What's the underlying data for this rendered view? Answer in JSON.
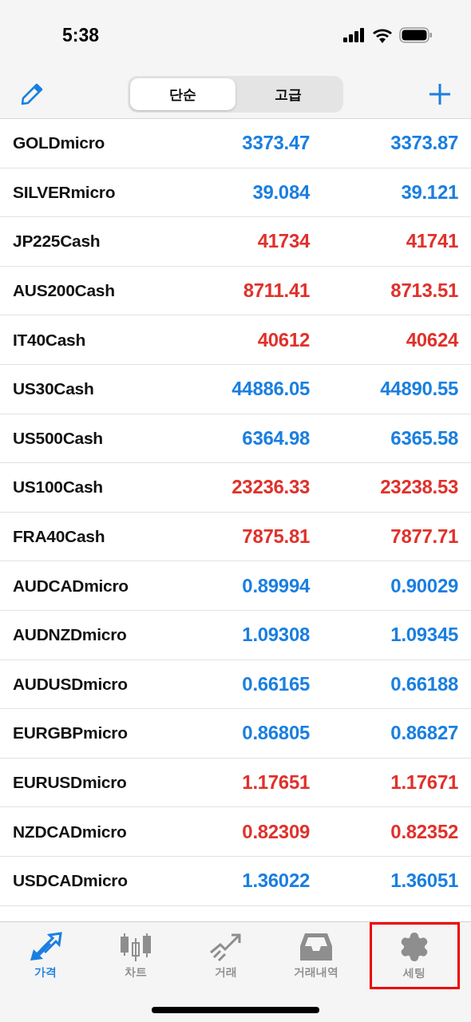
{
  "status_bar": {
    "time": "5:38"
  },
  "segments": [
    {
      "label": "단순",
      "selected": true
    },
    {
      "label": "고급",
      "selected": false
    }
  ],
  "quotes": [
    {
      "symbol": "GOLDmicro",
      "bid": "3373.47",
      "ask": "3373.87",
      "color": "#1a7fe0"
    },
    {
      "symbol": "SILVERmicro",
      "bid": "39.084",
      "ask": "39.121",
      "color": "#1a7fe0"
    },
    {
      "symbol": "JP225Cash",
      "bid": "41734",
      "ask": "41741",
      "color": "#e0312b"
    },
    {
      "symbol": "AUS200Cash",
      "bid": "8711.41",
      "ask": "8713.51",
      "color": "#e0312b"
    },
    {
      "symbol": "IT40Cash",
      "bid": "40612",
      "ask": "40624",
      "color": "#e0312b"
    },
    {
      "symbol": "US30Cash",
      "bid": "44886.05",
      "ask": "44890.55",
      "color": "#1a7fe0"
    },
    {
      "symbol": "US500Cash",
      "bid": "6364.98",
      "ask": "6365.58",
      "color": "#1a7fe0"
    },
    {
      "symbol": "US100Cash",
      "bid": "23236.33",
      "ask": "23238.53",
      "color": "#e0312b"
    },
    {
      "symbol": "FRA40Cash",
      "bid": "7875.81",
      "ask": "7877.71",
      "color": "#e0312b"
    },
    {
      "symbol": "AUDCADmicro",
      "bid": "0.89994",
      "ask": "0.90029",
      "color": "#1a7fe0"
    },
    {
      "symbol": "AUDNZDmicro",
      "bid": "1.09308",
      "ask": "1.09345",
      "color": "#1a7fe0"
    },
    {
      "symbol": "AUDUSDmicro",
      "bid": "0.66165",
      "ask": "0.66188",
      "color": "#1a7fe0"
    },
    {
      "symbol": "EURGBPmicro",
      "bid": "0.86805",
      "ask": "0.86827",
      "color": "#1a7fe0"
    },
    {
      "symbol": "EURUSDmicro",
      "bid": "1.17651",
      "ask": "1.17671",
      "color": "#e0312b"
    },
    {
      "symbol": "NZDCADmicro",
      "bid": "0.82309",
      "ask": "0.82352",
      "color": "#e0312b"
    },
    {
      "symbol": "USDCADmicro",
      "bid": "1.36022",
      "ask": "1.36051",
      "color": "#1a7fe0"
    }
  ],
  "tab_bar": [
    {
      "kind": "quotes",
      "label": "가격",
      "selected": true,
      "highlighted": false
    },
    {
      "kind": "chart",
      "label": "차트",
      "selected": false,
      "highlighted": false
    },
    {
      "kind": "trade",
      "label": "거래",
      "selected": false,
      "highlighted": false
    },
    {
      "kind": "history",
      "label": "거래내역",
      "selected": false,
      "highlighted": false
    },
    {
      "kind": "settings",
      "label": "세팅",
      "selected": false,
      "highlighted": true
    }
  ]
}
